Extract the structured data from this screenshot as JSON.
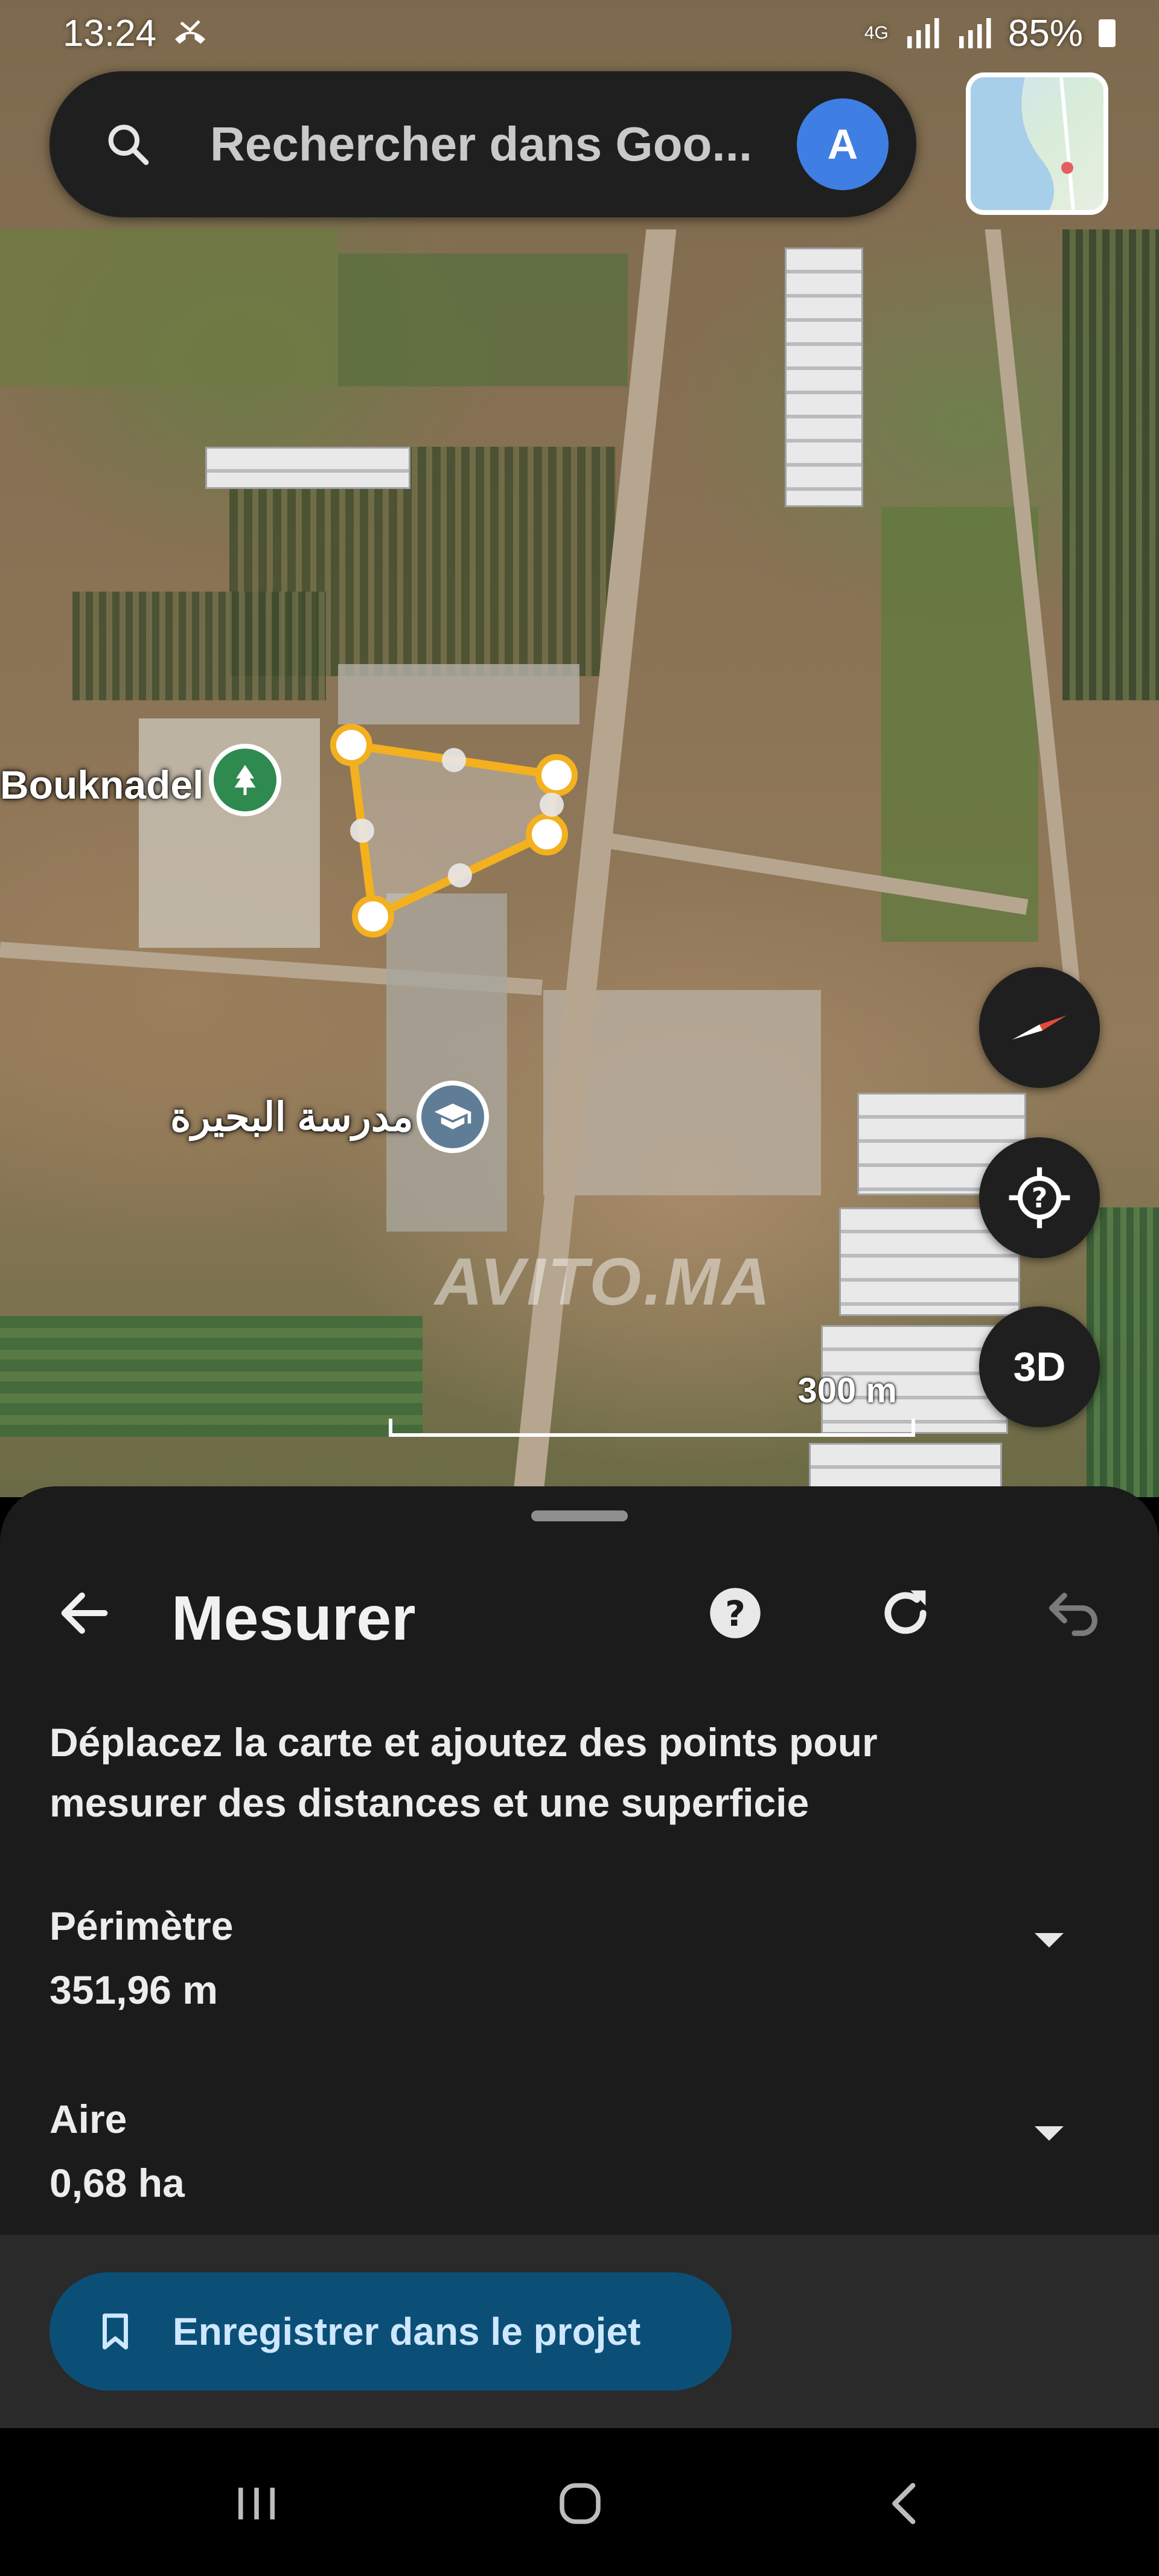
{
  "status_bar": {
    "time": "13:24",
    "network": "4G",
    "battery": "85%"
  },
  "search": {
    "placeholder": "Rechercher dans Goo...",
    "avatar_letter": "A"
  },
  "map": {
    "labels": {
      "place": "Bouknadel",
      "school": "مدرسة البحيرة"
    },
    "watermark": "AVITO.MA",
    "scale_label": "300 m",
    "button_3d": "3D"
  },
  "measure": {
    "title": "Mesurer",
    "instructions": "Déplacez la carte et ajoutez des points pour mesurer des distances et une superficie",
    "perimeter_label": "Périmètre",
    "perimeter_value": "351,96 m",
    "area_label": "Aire",
    "area_value": "0,68 ha",
    "save_button": "Enregistrer dans le projet"
  },
  "colors": {
    "accent": "#0b4f77",
    "polygon": "#f3b01f",
    "avatar": "#3f7fe3"
  }
}
